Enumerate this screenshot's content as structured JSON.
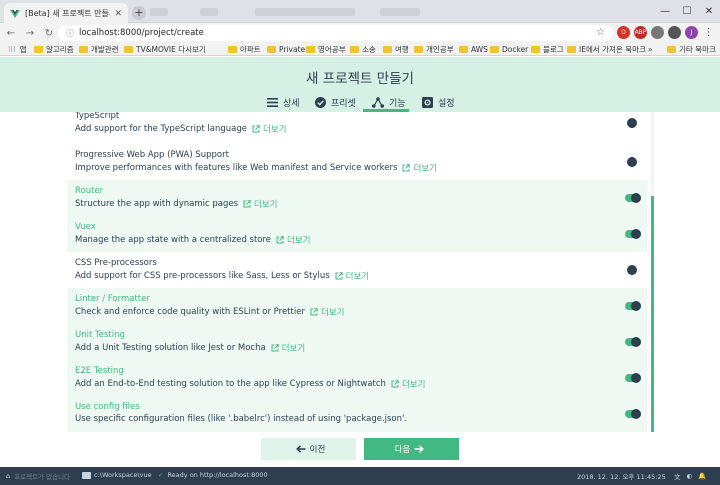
{
  "browser": {
    "tab_title": "[Beta] 새 프로젝트 만들기 - Vue",
    "url": "localhost:8000/project/create",
    "bookmarks": [
      "앱",
      "알고리즘",
      "개발관련",
      "TV&MOVIE 다시보기",
      "아파트",
      "Private",
      "영어공부",
      "소송",
      "여행",
      "개인공부",
      "AWS",
      "Docker",
      "블로그",
      "IE에서 가져온 북마크",
      "기타 북마크"
    ]
  },
  "header": {
    "title": "새 프로젝트 만들기",
    "tabs": [
      {
        "label": "상세",
        "icon": "list-icon"
      },
      {
        "label": "프리셋",
        "icon": "check-circle-icon"
      },
      {
        "label": "기능",
        "icon": "tree-icon"
      },
      {
        "label": "설정",
        "icon": "settings-icon"
      }
    ],
    "active_tab": "기능"
  },
  "features": [
    {
      "name": "TypeScript",
      "description": "Add support for the TypeScript language",
      "link": "더보기",
      "enabled": false
    },
    {
      "name": "Progressive Web App (PWA) Support",
      "description": "Improve performances with features like Web manifest and Service workers",
      "link": "더보기",
      "enabled": false
    },
    {
      "name": "Router",
      "description": "Structure the app with dynamic pages",
      "link": "더보기",
      "enabled": true
    },
    {
      "name": "Vuex",
      "description": "Manage the app state with a centralized store",
      "link": "더보기",
      "enabled": true
    },
    {
      "name": "CSS Pre-processors",
      "description": "Add support for CSS pre-processors like Sass, Less or Stylus",
      "link": "더보기",
      "enabled": false
    },
    {
      "name": "Linter / Formatter",
      "description": "Check and enforce code quality with ESLint or Prettier",
      "link": "더보기",
      "enabled": true
    },
    {
      "name": "Unit Testing",
      "description": "Add a Unit Testing solution like Jest or Mocha",
      "link": "더보기",
      "enabled": true
    },
    {
      "name": "E2E Testing",
      "description": "Add an End-to-End testing solution to the app like Cypress or Nightwatch",
      "link": "더보기",
      "enabled": true
    },
    {
      "name": "Use config files",
      "description": "Use specific configuration files (like '.babelrc') instead of using 'package.json'.",
      "link": "",
      "enabled": true
    }
  ],
  "footer": {
    "prev_label": "이전",
    "next_label": "다음"
  },
  "statusbar": {
    "left": "프로젝트가 없습니다",
    "path": "c:\\Workspace\\vue",
    "ready": "Ready on http://localhost:8000",
    "datetime": "2018. 12. 12. 오후 11:45:25"
  },
  "colors": {
    "accent": "#42b983",
    "dark": "#2c3e50",
    "header_bg": "#d5f0e4",
    "enabled_row_bg": "#eef9f3"
  }
}
